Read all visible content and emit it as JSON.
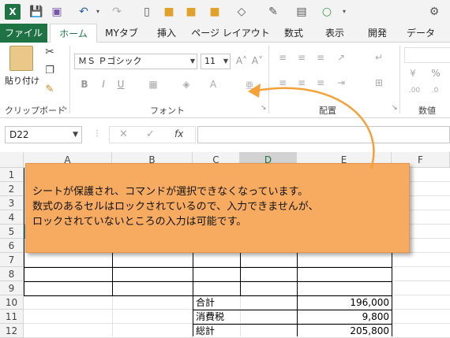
{
  "qat": {
    "app_icon_label": "X"
  },
  "tabs": [
    "ファイル",
    "ホーム",
    "MYタブ",
    "挿入",
    "ページ レイアウト",
    "数式",
    "表示",
    "開発",
    "データ"
  ],
  "ribbon": {
    "paste_label": "貼り付け",
    "font_name": "ＭＳ Ｐゴシック",
    "font_size": "11",
    "bold": "B",
    "italic": "I",
    "underline": "U",
    "groups": {
      "clipboard": "クリップボード",
      "font": "フォント",
      "alignment": "配置",
      "number": "数値"
    },
    "increase_font": "A˄",
    "decrease_font": "A˅",
    "percent": "%"
  },
  "formula_bar": {
    "name_box": "D22",
    "cancel": "✕",
    "enter": "✓",
    "fx": "fx"
  },
  "columns": [
    "A",
    "B",
    "C",
    "D",
    "E",
    "F"
  ],
  "rows": [
    "1",
    "2",
    "3",
    "4",
    "5",
    "6",
    "7",
    "8",
    "9",
    "10",
    "11",
    "12"
  ],
  "cells": {
    "c10": "合計",
    "e10": "196,000",
    "c11": "消費税",
    "e11": "9,800",
    "c12": "総計",
    "e12": "205,800"
  },
  "callout": {
    "line1": "シートが保護され、コマンドが選択できなくなっています。",
    "line2": "数式のあるセルはロックされているので、入力できませんが、",
    "line3": "ロックされていないところの入力は可能です。"
  },
  "colors": {
    "excel_green": "#1f7244",
    "callout_fill": "#f6ab60",
    "arrow": "#f4a13a"
  }
}
